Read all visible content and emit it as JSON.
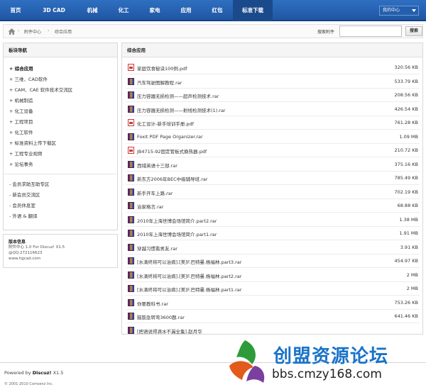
{
  "topnav": {
    "items": [
      "首页",
      "3D CAD",
      "机械",
      "化工",
      "家电",
      "应用",
      "红包",
      "标准下载"
    ],
    "my_center": "我的中心"
  },
  "breadcrumb": {
    "items": [
      "附件中心",
      "综合应用"
    ],
    "search_label": "搜索附件",
    "search_value": "",
    "search_button": "搜索"
  },
  "sidebar": {
    "title": "板块导航",
    "items": [
      "+ 综合应用",
      "+ 三维、CAD软件",
      "+ CAM、CAE 软件技术交流区",
      "+ 机械制造",
      "+ 化工设备",
      "+ 工程项目",
      "+ 化工软件",
      "+ 标准资料上传下载区",
      "+ 工程专业视频",
      "+ 论坛事务"
    ],
    "items2": [
      "- 会员求助互助专区",
      "- 新会员交流区",
      "- 会员休息室",
      "- 外语 & 翻译"
    ],
    "powered": {
      "title": "版本信息",
      "lines": [
        "附件中心 1.0 For Discuz! X1.5",
        "@QQ:272116623",
        "www.hgcad.com"
      ]
    }
  },
  "main": {
    "title": "综合应用",
    "files": [
      {
        "name": "家庭饮食秘诀100例.pdf",
        "size": "320.56 KB",
        "type": "pdf"
      },
      {
        "name": "汽车驾驶图解教程.rar",
        "size": "533.79 KB",
        "type": "rar"
      },
      {
        "name": "压力容器无损检测——超声检测技术.rar",
        "size": "208.56 KB",
        "type": "rar"
      },
      {
        "name": "压力容器无损检测——射线检测技术(1).rar",
        "size": "426.54 KB",
        "type": "rar"
      },
      {
        "name": "化工设计-新手培训手册.pdf",
        "size": "761.28 KB",
        "type": "pdf"
      },
      {
        "name": "Foxit PDF Page Organizer.rar",
        "size": "1.09 MB",
        "type": "rar"
      },
      {
        "name": "JB4715-92固定管板式换热器.pdf",
        "size": "210.72 KB",
        "type": "pdf"
      },
      {
        "name": "西域英语十三部.rar",
        "size": "375.16 KB",
        "type": "rar"
      },
      {
        "name": "新东方2006年BEC中级辅导班.rar",
        "size": "785.49 KB",
        "type": "rar"
      },
      {
        "name": "新手开车上路.rar",
        "size": "702.19 KB",
        "type": "rar"
      },
      {
        "name": "治家格言.rar",
        "size": "68.88 KB",
        "type": "rar"
      },
      {
        "name": "2010年上海世博会场馆简介.part2.rar",
        "size": "1.38 MB",
        "type": "rar"
      },
      {
        "name": "2010年上海世博会场馆简介.part1.rar",
        "size": "1.91 MB",
        "type": "rar"
      },
      {
        "name": "穿越习惯看男友.rar",
        "size": "3.91 KB",
        "type": "rar"
      },
      {
        "name": "[水滴终将可以治病].[美]F.巴特曼.杨福林.part3.rar",
        "size": "454.97 KB",
        "type": "rar"
      },
      {
        "name": "[水滴终将可以治病].[美]F.巴特曼.杨福林.part2.rar",
        "size": "2 MB",
        "type": "rar"
      },
      {
        "name": "[水滴终将可以治病].[美]F.巴特曼.杨福林.part1.rar",
        "size": "2 MB",
        "type": "rar"
      },
      {
        "name": "你要教科书.rar",
        "size": "753.26 KB",
        "type": "rar"
      },
      {
        "name": "脑筋急转弯3600题.rar",
        "size": "641.46 KB",
        "type": "rar"
      },
      {
        "name": "[把语说得滴水不漏全集].赵月华",
        "size": "",
        "type": "rar"
      }
    ]
  },
  "footer": {
    "powered_by": "Powered by",
    "brand": "Discuz!",
    "version": "X1.5",
    "copyright": "© 2001-2010 Comsenz Inc."
  },
  "watermark": {
    "title": "创盟资源论坛",
    "url": "bbs.cmzy168.com"
  },
  "colors": {
    "nav_bg": "#1f56a3",
    "nav_active_bg": "#f2f2f2",
    "watermark_blue": "#1a73c9"
  }
}
